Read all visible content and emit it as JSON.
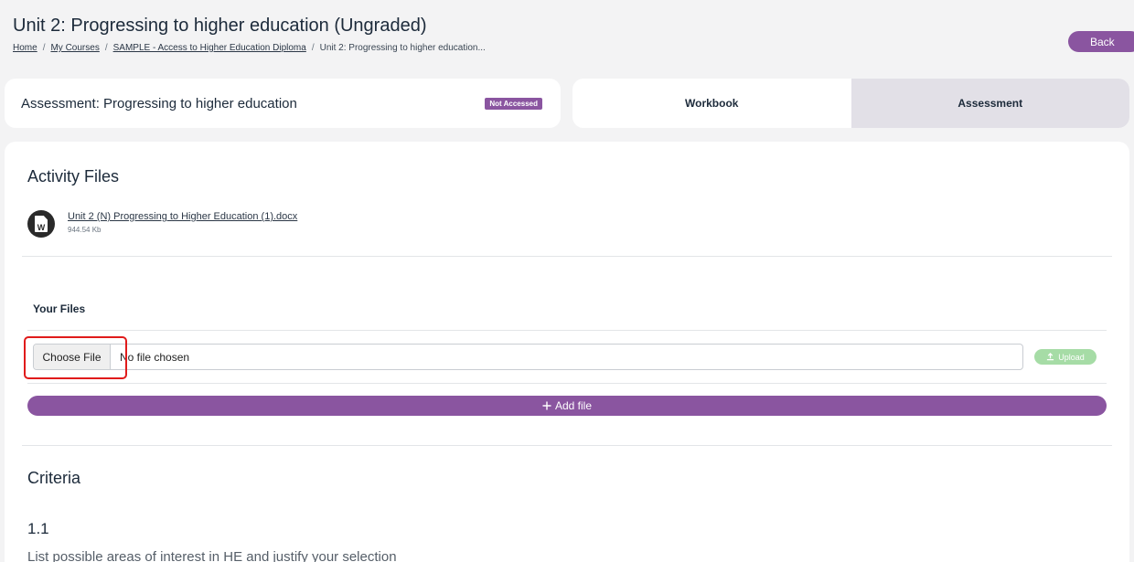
{
  "header": {
    "title": "Unit 2: Progressing to higher education (Ungraded)",
    "breadcrumb": [
      "Home",
      "My Courses",
      "SAMPLE - Access to Higher Education Diploma",
      "Unit 2: Progressing to higher education..."
    ],
    "back_label": "Back"
  },
  "assessment": {
    "title": "Assessment: Progressing to higher education",
    "status": "Not Accessed"
  },
  "tabs": [
    {
      "label": "Workbook",
      "active": false
    },
    {
      "label": "Assessment",
      "active": true
    }
  ],
  "activity_files": {
    "title": "Activity Files",
    "files": [
      {
        "name": "Unit 2 (N) Progressing to Higher Education (1).docx",
        "size": "944.54 Kb",
        "icon": "word-doc-icon"
      }
    ]
  },
  "your_files": {
    "title": "Your Files",
    "choose_label": "Choose File",
    "status": "No file chosen",
    "upload_label": "Upload",
    "add_label": "Add file"
  },
  "criteria": {
    "title": "Criteria",
    "items": [
      {
        "number": "1.1",
        "text": "List possible areas of interest in HE and justify your selection"
      }
    ]
  },
  "colors": {
    "accent": "#8a55a0",
    "upload_disabled": "#a6dca6",
    "highlight": "#e01b1b"
  }
}
